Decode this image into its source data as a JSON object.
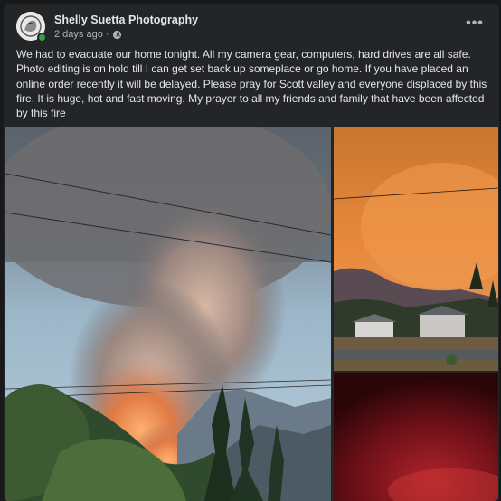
{
  "post": {
    "author": "Shelly Suetta Photography",
    "timestamp": "2 days ago",
    "separator": "·",
    "privacy_icon": "globe-icon",
    "more_icon": "more-options-icon",
    "more_label": "•••",
    "text": "We had to evacuate our home tonight. All my camera gear, computers, hard drives are all safe. Photo editing is on hold till I can get set back up someplace or go home. If you have placed an online order recently it will be delayed. Please pray for Scott valley and everyone displaced by this fire. It is huge, hot and fast moving. My prayer to all my friends and family that have been affected by this fire"
  },
  "photos": [
    {
      "subject": "fire-smoke-plume-photo"
    },
    {
      "subject": "orange-sky-houses-photo"
    },
    {
      "subject": "red-glow-night-photo"
    }
  ],
  "colors": {
    "background": "#18191a",
    "card": "#242526",
    "primary_text": "#e4e6eb",
    "secondary_text": "#b0b3b8",
    "online": "#31a24c"
  }
}
